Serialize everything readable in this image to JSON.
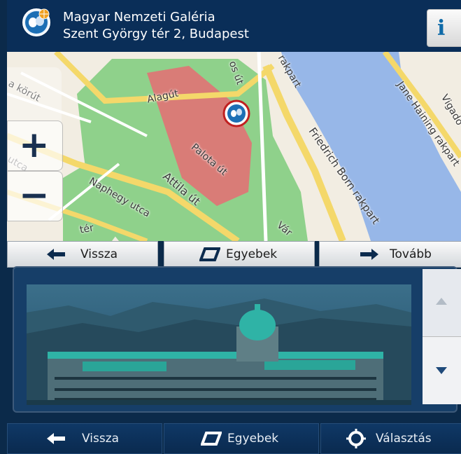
{
  "header": {
    "poi_name": "Magyar Nemzeti Galéria",
    "address": "Szent György tér 2, Budapest",
    "info_icon": "info-icon"
  },
  "map": {
    "streets": {
      "korut": "a körút",
      "utca1": "utca",
      "utca2": "utca",
      "alagut": "Alagút",
      "os_ut": "os út",
      "rakpart_top": "rakpart",
      "palota_ut": "Palota út",
      "attila_ut": "Attila út",
      "naphegy": "Naphegy utca",
      "ter": "tér",
      "var": "Vár",
      "friedrich": "Friedrich Born rakpart",
      "jane": "Jane Haining rakpart",
      "vigado": "Vigadó"
    },
    "zoom_in_symbol": "+",
    "zoom_out_symbol": "−"
  },
  "top_nav": {
    "back_label": "Vissza",
    "more_label": "Egyebek",
    "next_label": "Tovább"
  },
  "bottom_nav": {
    "back_label": "Vissza",
    "more_label": "Egyebek",
    "select_label": "Választás"
  },
  "colors": {
    "header_bg": "#0a2e58",
    "map_green": "#8fd18b",
    "water": "#97b7e8",
    "building": "#d97c77",
    "road_yellow": "#f4d86a"
  }
}
